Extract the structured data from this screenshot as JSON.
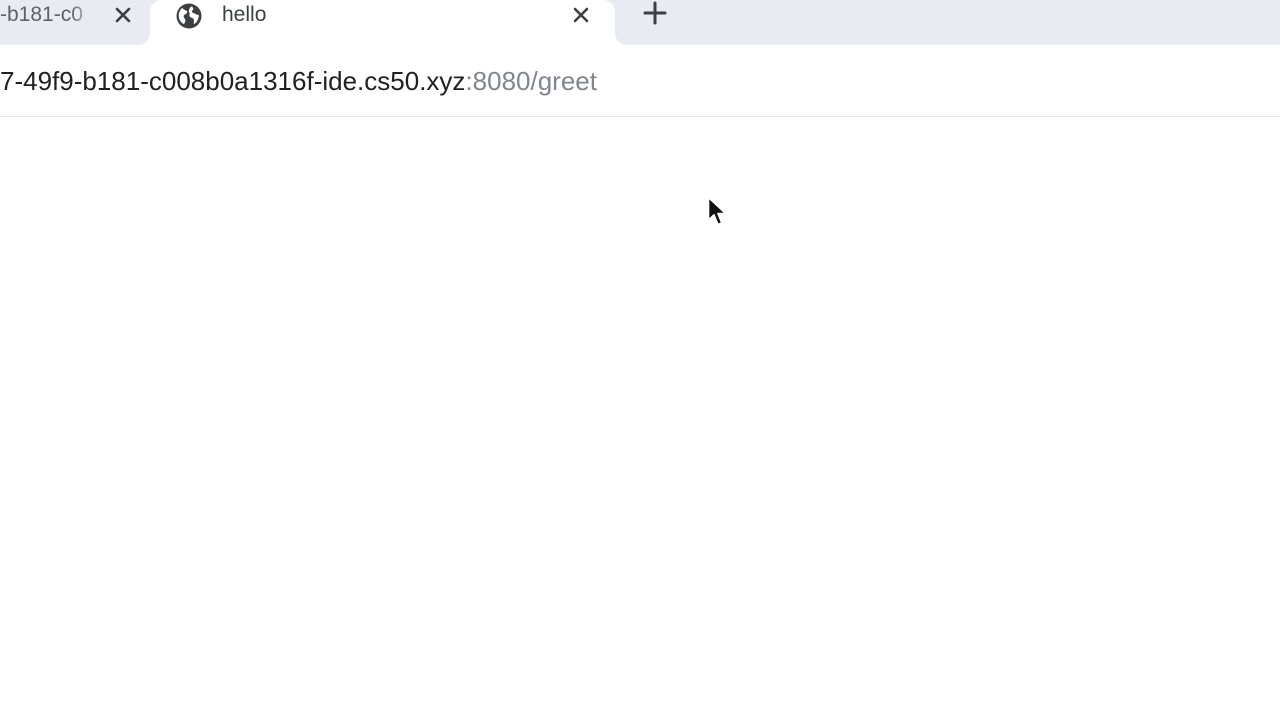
{
  "tabs": [
    {
      "title": "-b181-c0",
      "active": false,
      "close_icon": "close-icon"
    },
    {
      "title": "hello",
      "active": true,
      "favicon": "globe-icon",
      "close_icon": "close-icon"
    }
  ],
  "new_tab_icon": "plus-icon",
  "address_bar": {
    "host": "7-49f9-b181-c008b0a1316f-ide.cs50.xyz",
    "path": ":8080/greet"
  },
  "page": {
    "content": ""
  },
  "pointer": "mouse-pointer-icon",
  "colors": {
    "tabstrip_bg": "#e8ebf2",
    "active_tab_bg": "#ffffff",
    "text_primary": "#202124",
    "text_secondary": "#80868b",
    "icon": "#3c4043"
  }
}
